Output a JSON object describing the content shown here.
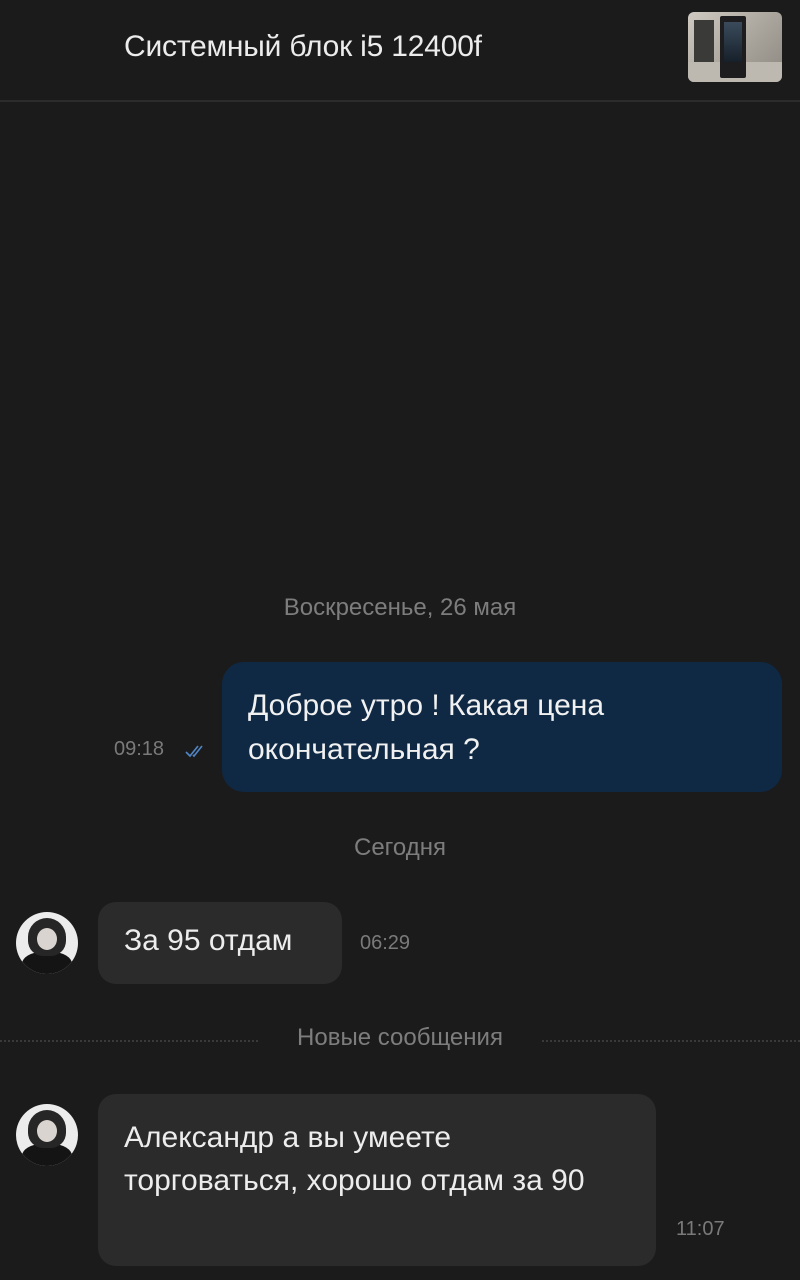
{
  "header": {
    "title": "Системный блок i5 12400f",
    "thumbnail_icon": "product-photo-thumbnail"
  },
  "chat": {
    "date_separators": [
      "Воскресенье, 26 мая",
      "Сегодня"
    ],
    "new_messages_label": "Новые сообщения",
    "messages": [
      {
        "direction": "outgoing",
        "text": "Доброе утро ! Какая цена окончательная ?",
        "time": "09:18",
        "status": "read"
      },
      {
        "direction": "incoming",
        "text": "За 95 отдам",
        "time": "06:29"
      },
      {
        "direction": "incoming",
        "text": "Александр а вы умеете торговаться, хорошо отдам за 90",
        "time": "11:07"
      }
    ]
  },
  "colors": {
    "background": "#1b1b1b",
    "outgoing_bubble": "#0f2945",
    "incoming_bubble": "#2b2b2b",
    "read_check": "#4f86c6"
  }
}
